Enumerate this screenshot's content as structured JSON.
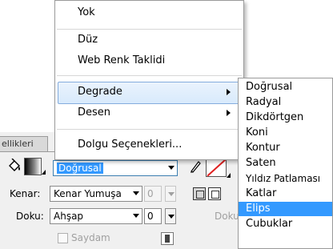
{
  "menu": {
    "items": [
      {
        "label": "Yok",
        "has_submenu": false
      },
      {
        "label": "Düz",
        "has_submenu": false
      },
      {
        "label": "Web Renk Taklidi",
        "has_submenu": false
      },
      {
        "label": "Degrade",
        "has_submenu": true
      },
      {
        "label": "Desen",
        "has_submenu": true
      },
      {
        "label": "Dolgu Seçenekleri...",
        "has_submenu": false
      }
    ],
    "highlighted": "Degrade"
  },
  "submenu": {
    "items": [
      "Doğrusal",
      "Radyal",
      "Dikdörtgen",
      "Koni",
      "Kontur",
      "Saten",
      "Yıldız Patlaması",
      "Katlar",
      "Elips",
      "Çubuklar"
    ],
    "selected": "Elips",
    "visible_partial_last": "Cubuklar"
  },
  "panel": {
    "tab_label": "ellikleri",
    "fill_type": {
      "value": "Doğrusal"
    },
    "edge": {
      "label": "Kenar:",
      "value": "Kenar Yumuşa",
      "amount": "0"
    },
    "texture": {
      "label": "Doku:",
      "value": "Ahşap",
      "amount": "0"
    },
    "texture_right_label": "Doku",
    "transparent": {
      "label": "Saydam",
      "checked": false
    }
  },
  "icons": {
    "fill": "paint-bucket-icon",
    "pencil": "pencil-icon",
    "stroke": "no-stroke-icon"
  },
  "colors": {
    "selection": "#3399ff",
    "highlight_border": "#84acdd"
  }
}
